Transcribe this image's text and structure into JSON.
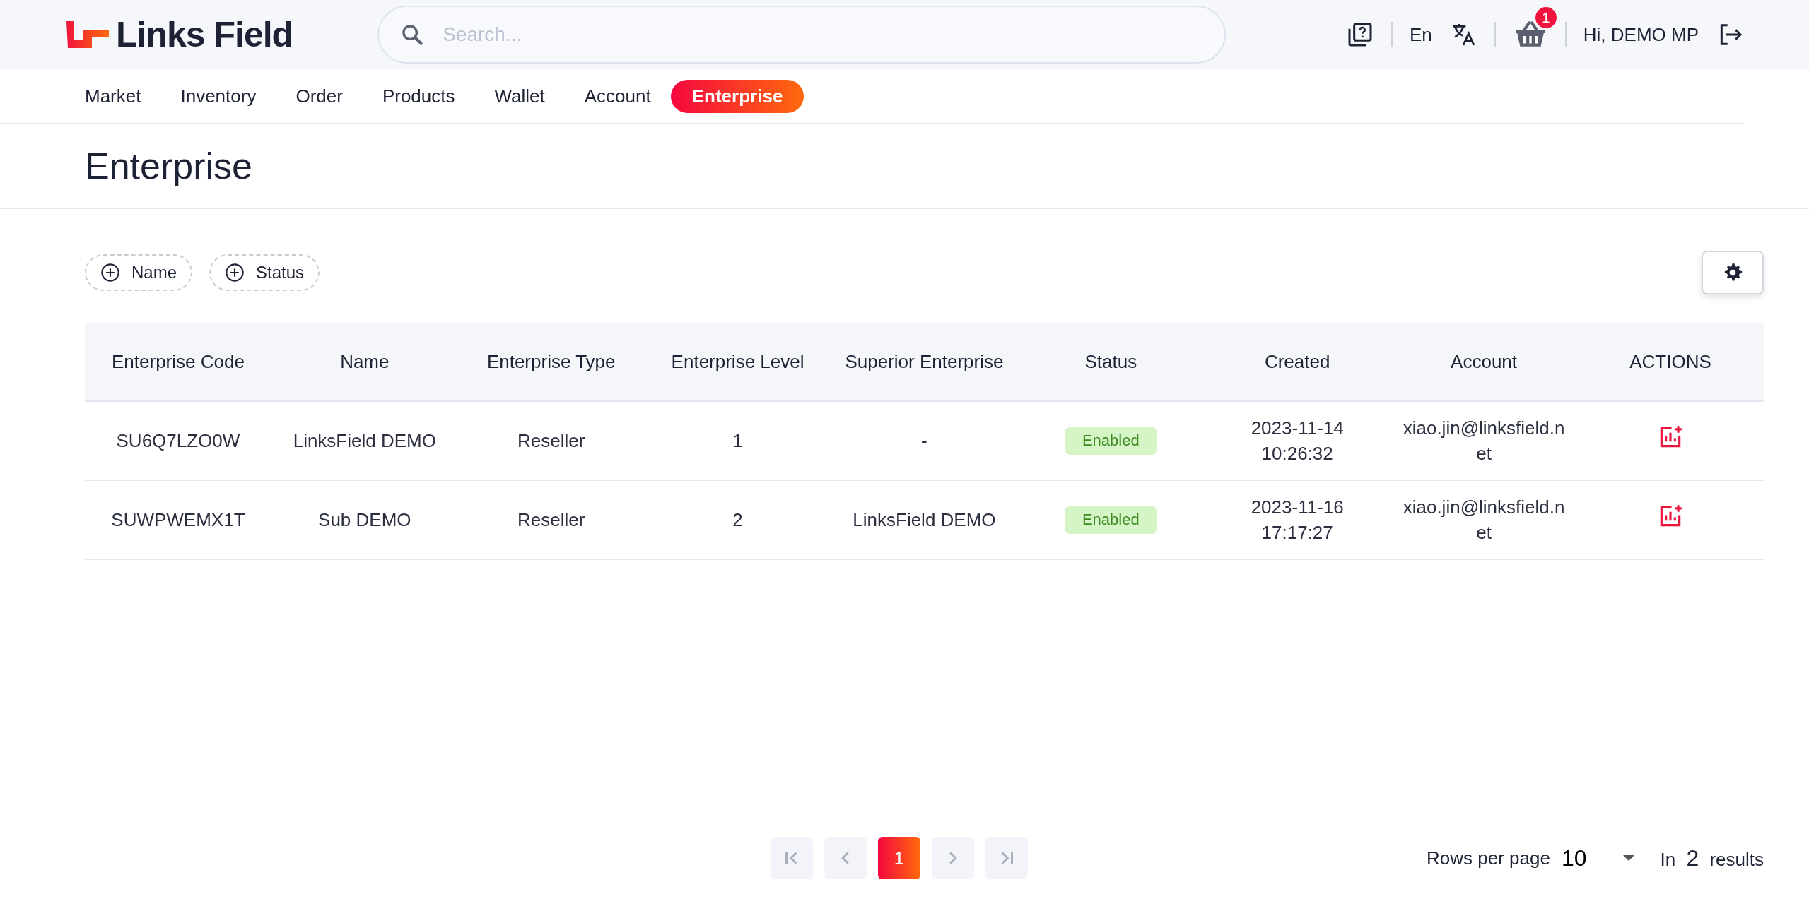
{
  "header": {
    "logo_text": "Links Field",
    "search": {
      "placeholder": "Search..."
    },
    "language": "En",
    "cart_count": "1",
    "greeting": "Hi, DEMO MP"
  },
  "nav": [
    {
      "label": "Market",
      "selected": false
    },
    {
      "label": "Inventory",
      "selected": false
    },
    {
      "label": "Order",
      "selected": false
    },
    {
      "label": "Products",
      "selected": false
    },
    {
      "label": "Wallet",
      "selected": false
    },
    {
      "label": "Account",
      "selected": false
    },
    {
      "label": "Enterprise",
      "selected": true
    }
  ],
  "page_title": "Enterprise",
  "filters": [
    "Name",
    "Status"
  ],
  "table": {
    "columns": [
      "Enterprise Code",
      "Name",
      "Enterprise Type",
      "Enterprise Level",
      "Superior Enterprise",
      "Status",
      "Created",
      "Account",
      "ACTIONS"
    ],
    "rows": [
      {
        "code": "SU6Q7LZO0W",
        "name": "LinksField DEMO",
        "type": "Reseller",
        "level": "1",
        "superior": "-",
        "status": "Enabled",
        "created": [
          "2023-11-14",
          "10:26:32"
        ],
        "account": "xiao.jin@linksfield.net"
      },
      {
        "code": "SUWPWEMX1T",
        "name": "Sub DEMO",
        "type": "Reseller",
        "level": "2",
        "superior": "LinksField DEMO",
        "status": "Enabled",
        "created": [
          "2023-11-16",
          "17:17:27"
        ],
        "account": "xiao.jin@linksfield.net"
      }
    ]
  },
  "pagination": {
    "pages": [
      {
        "label": "1",
        "selected": true
      }
    ],
    "rows_per_page_label": "Rows per page",
    "rows_per_page": "10",
    "results_prefix": "In",
    "results_count": "2",
    "results_suffix": "results"
  }
}
